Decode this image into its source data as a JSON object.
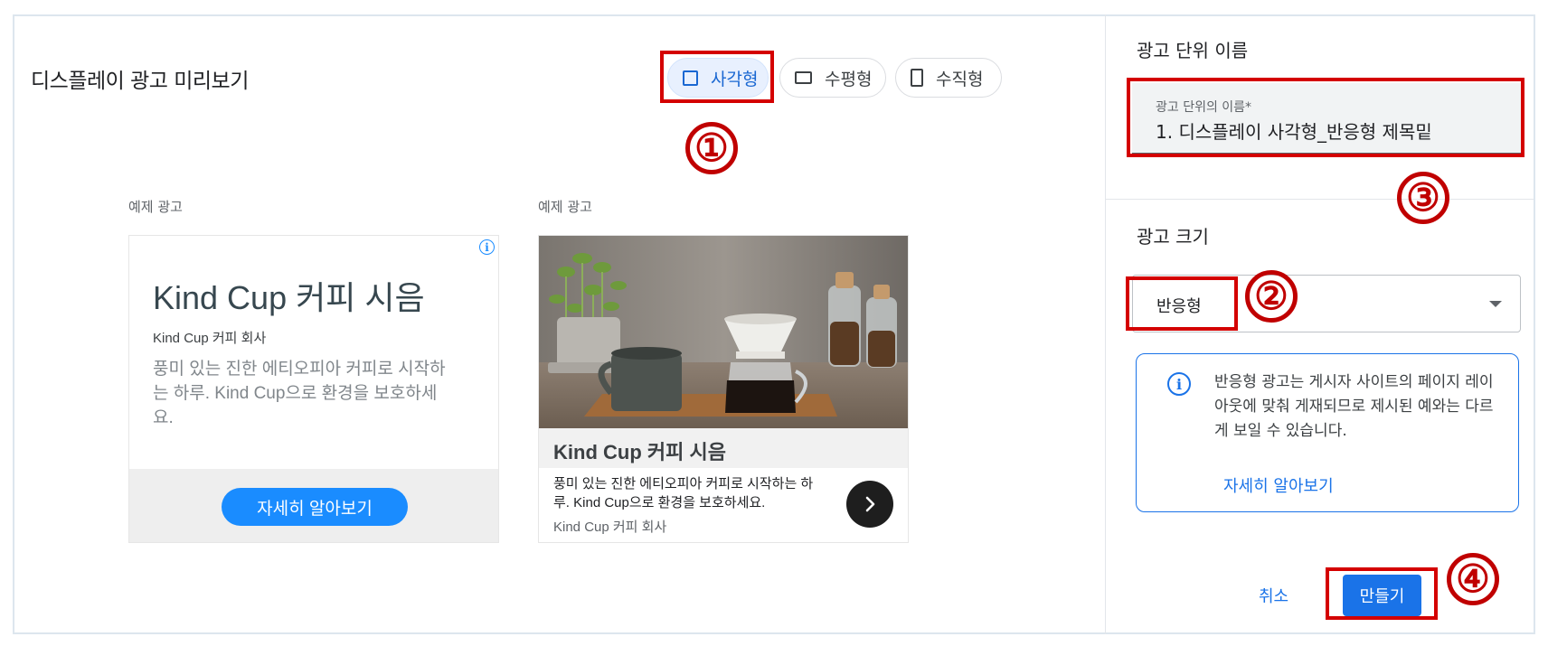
{
  "preview": {
    "title": "디스플레이 광고 미리보기",
    "formats": [
      {
        "label": "사각형",
        "icon": "square-icon",
        "selected": true
      },
      {
        "label": "수평형",
        "icon": "horizontal-rect-icon",
        "selected": false
      },
      {
        "label": "수직형",
        "icon": "vertical-rect-icon",
        "selected": false
      }
    ],
    "sample_label": "예제 광고",
    "ad_text": {
      "headline": "Kind Cup 커피 시음",
      "advertiser": "Kind Cup 커피 회사",
      "description": "풍미 있는 진한 에티오피아 커피로 시작하는 하루. Kind Cup으로 환경을 보호하세요.",
      "cta": "자세히 알아보기",
      "info_icon": "info-icon",
      "next_icon": "chevron-right-icon"
    }
  },
  "ad_unit": {
    "section_title": "광고 단위 이름",
    "field_label": "광고 단위의 이름*",
    "field_value": "1. 디스플레이 사각형_반응형 제목밑"
  },
  "ad_size": {
    "section_title": "광고 크기",
    "selected": "반응형",
    "notice": "반응형 광고는 게시자 사이트의 페이지 레이아웃에 맞춰 게재되므로 제시된 예와는 다르게 보일 수 있습니다.",
    "learn_more": "자세히 알아보기"
  },
  "actions": {
    "cancel": "취소",
    "create": "만들기"
  },
  "annotations": [
    "①",
    "②",
    "③",
    "④"
  ],
  "colors": {
    "accent": "#1a73e8",
    "ad_cta": "#1a8cff",
    "highlight": "#d40000"
  }
}
